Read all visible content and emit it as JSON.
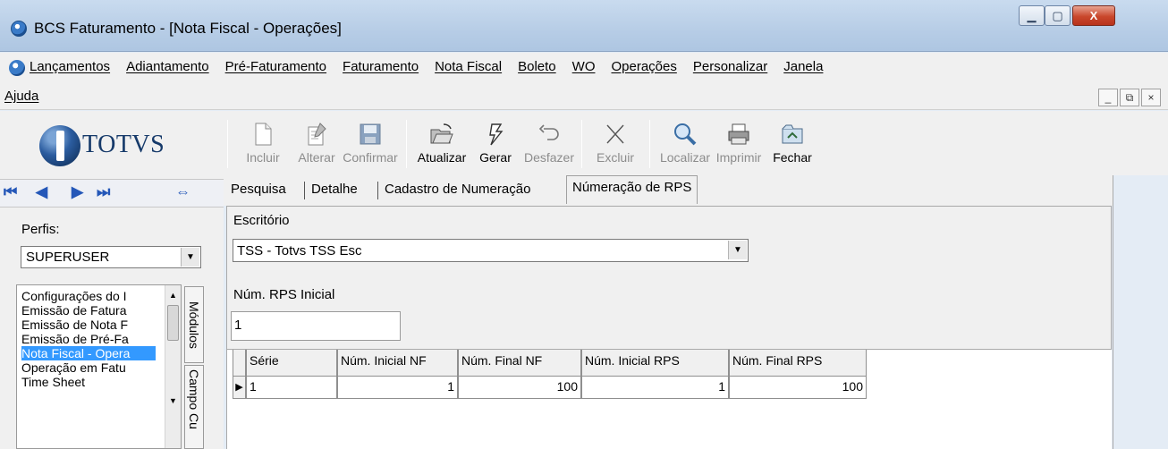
{
  "window": {
    "title": "BCS Faturamento - [Nota Fiscal - Operações]",
    "min_glyph": "▁",
    "max_glyph": "▢",
    "close_glyph": "X"
  },
  "menu": {
    "items": [
      "Lançamentos",
      "Adiantamento",
      "Pré-Faturamento",
      "Faturamento",
      "Nota Fiscal",
      "Boleto",
      "WO",
      "Operações",
      "Personalizar",
      "Janela"
    ],
    "help": "Ajuda",
    "mdi": {
      "min": "_",
      "restore": "⧉",
      "close": "×"
    }
  },
  "logo": {
    "text": "TOTVS"
  },
  "nav": {
    "first": "⏮",
    "prev": "◀",
    "next": "▶",
    "last": "⏭",
    "sync": "⇔"
  },
  "profile": {
    "label": "Perfis:",
    "value": "SUPERUSER"
  },
  "modules": {
    "items": [
      "Configurações do I",
      "Emissão de Fatura",
      "Emissão de Nota F",
      "Emissão de Pré-Fa",
      "Nota Fiscal - Opera",
      "Operação em Fatu",
      "Time Sheet"
    ],
    "selected_index": 4,
    "tab_modulos": "Módulos",
    "tab_campo": "Campo Cu"
  },
  "toolbar": {
    "incluir": "Incluir",
    "alterar": "Alterar",
    "confirmar": "Confirmar",
    "atualizar": "Atualizar",
    "gerar": "Gerar",
    "desfazer": "Desfazer",
    "excluir": "Excluir",
    "localizar": "Localizar",
    "imprimir": "Imprimir",
    "fechar": "Fechar"
  },
  "tabs": {
    "pesquisa": "Pesquisa",
    "detalhe": "Detalhe",
    "cadastro": "Cadastro de Numeração",
    "rps": "Númeração de RPS"
  },
  "form": {
    "escritorio_label": "Escritório",
    "escritorio_value": "TSS - Totvs TSS Esc",
    "rps_label": "Núm. RPS Inicial",
    "rps_value": "1"
  },
  "grid": {
    "columns": [
      "Série",
      "Núm. Inicial NF",
      "Núm. Final NF",
      "Núm. Inicial RPS",
      "Núm. Final RPS"
    ],
    "rows": [
      [
        "1",
        "1",
        "100",
        "1",
        "100"
      ]
    ],
    "row_indicator": "▶"
  }
}
